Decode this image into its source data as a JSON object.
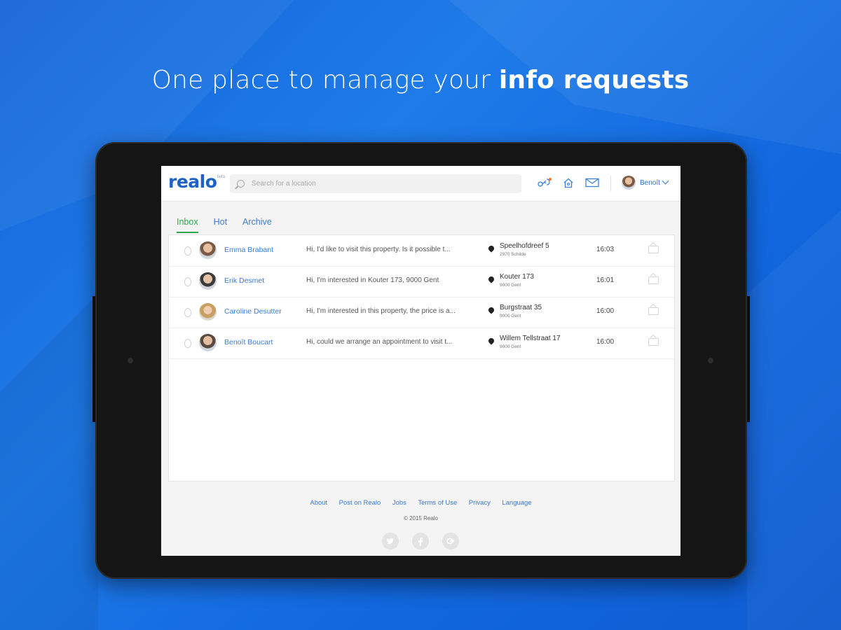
{
  "headline": {
    "normal": "One place to manage your ",
    "bold": "info requests"
  },
  "app": {
    "logo": "realo",
    "logo_mark": "beta",
    "search_placeholder": "Search for a location",
    "user_name": "Benoît"
  },
  "tabs": [
    {
      "label": "Inbox",
      "active": true
    },
    {
      "label": "Hot",
      "active": false
    },
    {
      "label": "Archive",
      "active": false
    }
  ],
  "messages": [
    {
      "sender": "Emma Brabant",
      "preview": "Hi, I'd like to visit this property. Is it possible t...",
      "street": "Speelhofdreef 5",
      "city": "2970 Schilde",
      "time": "16:03"
    },
    {
      "sender": "Erik Desmet",
      "preview": "Hi, I'm interested in Kouter 173, 9000 Gent",
      "street": "Kouter 173",
      "city": "9000 Gent",
      "time": "16:01"
    },
    {
      "sender": "Caroline Desutter",
      "preview": "Hi, I'm interested in this property, the price is a...",
      "street": "Burgstraat 35",
      "city": "9000 Gent",
      "time": "16:00"
    },
    {
      "sender": "Benoît Boucart",
      "preview": "Hi, could we arrange an appointment to visit t...",
      "street": "Willem Tellstraat 17",
      "city": "9000 Gent",
      "time": "16:00"
    }
  ],
  "footer": {
    "links": [
      "About",
      "Post on Realo",
      "Jobs",
      "Terms of Use",
      "Privacy",
      "Language"
    ],
    "copyright": "© 2015 Realo"
  },
  "colors": {
    "brand_blue": "#1e62c8",
    "active_tab_green": "#2ea84f",
    "background_blue": "#1a6fe0"
  },
  "icons": [
    "search-icon",
    "key-icon",
    "house-icon",
    "mail-icon",
    "chevron-down-icon",
    "flame-icon",
    "location-pin-icon",
    "archive-icon",
    "twitter-icon",
    "facebook-icon",
    "google-plus-icon"
  ]
}
